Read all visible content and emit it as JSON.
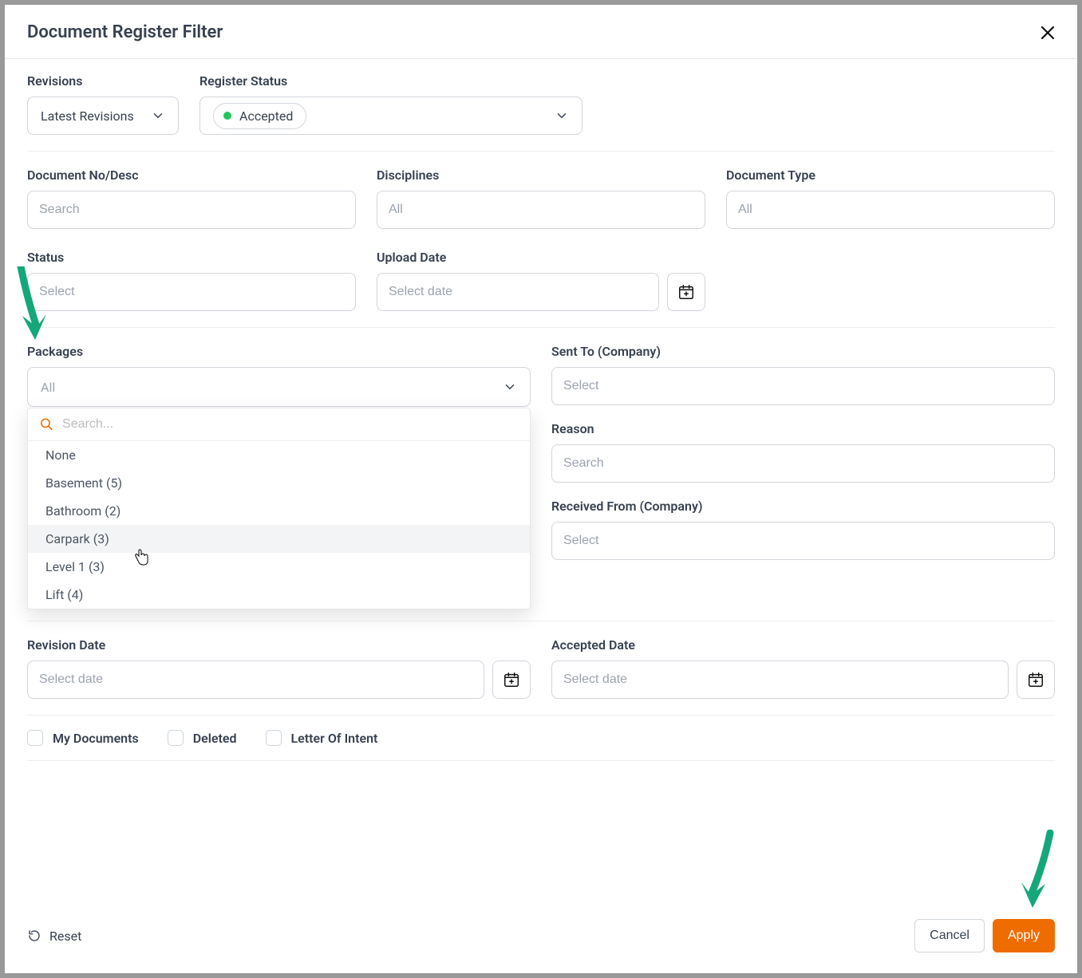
{
  "header": {
    "title": "Document Register Filter"
  },
  "fields": {
    "revisions": {
      "label": "Revisions",
      "value": "Latest Revisions"
    },
    "register_status": {
      "label": "Register Status",
      "chip": "Accepted"
    },
    "doc_no": {
      "label": "Document No/Desc",
      "placeholder": "Search"
    },
    "disciplines": {
      "label": "Disciplines",
      "placeholder": "All"
    },
    "doc_type": {
      "label": "Document Type",
      "placeholder": "All"
    },
    "status": {
      "label": "Status",
      "placeholder": "Select"
    },
    "upload_date": {
      "label": "Upload Date",
      "placeholder": "Select date"
    },
    "packages": {
      "label": "Packages",
      "placeholder": "All"
    },
    "sent_to": {
      "label": "Sent To (Company)",
      "placeholder": "Select"
    },
    "reason": {
      "label": "Reason",
      "placeholder": "Search"
    },
    "received_from": {
      "label": "Received From (Company)",
      "placeholder": "Select"
    },
    "revision_date": {
      "label": "Revision Date",
      "placeholder": "Select date"
    },
    "accepted_date": {
      "label": "Accepted Date",
      "placeholder": "Select date"
    }
  },
  "packages_dropdown": {
    "search_placeholder": "Search...",
    "items": [
      "None",
      "Basement (5)",
      "Bathroom (2)",
      "Carpark (3)",
      "Level 1 (3)",
      "Lift (4)"
    ],
    "hover_index": 3
  },
  "checkboxes": {
    "my_docs": "My Documents",
    "deleted": "Deleted",
    "loi": "Letter Of Intent"
  },
  "footer": {
    "reset": "Reset",
    "cancel": "Cancel",
    "apply": "Apply"
  }
}
